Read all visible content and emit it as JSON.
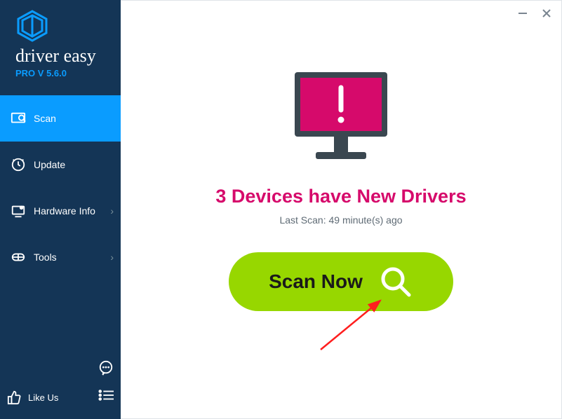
{
  "brand": {
    "name": "driver easy",
    "version": "PRO V 5.6.0"
  },
  "sidebar": {
    "items": [
      {
        "label": "Scan",
        "icon": "scan-icon",
        "active": true,
        "hasChevron": false
      },
      {
        "label": "Update",
        "icon": "update-icon",
        "active": false,
        "hasChevron": false
      },
      {
        "label": "Hardware Info",
        "icon": "hardware-icon",
        "active": false,
        "hasChevron": true
      },
      {
        "label": "Tools",
        "icon": "tools-icon",
        "active": false,
        "hasChevron": true
      }
    ],
    "likeUsLabel": "Like Us"
  },
  "main": {
    "headline": "3 Devices have New Drivers",
    "subline": "Last Scan: 49 minute(s) ago",
    "scanButtonLabel": "Scan Now"
  },
  "colors": {
    "accent": "#0a9cff",
    "sidebar": "#143556",
    "alert": "#d60a6b",
    "action": "#97d700"
  }
}
